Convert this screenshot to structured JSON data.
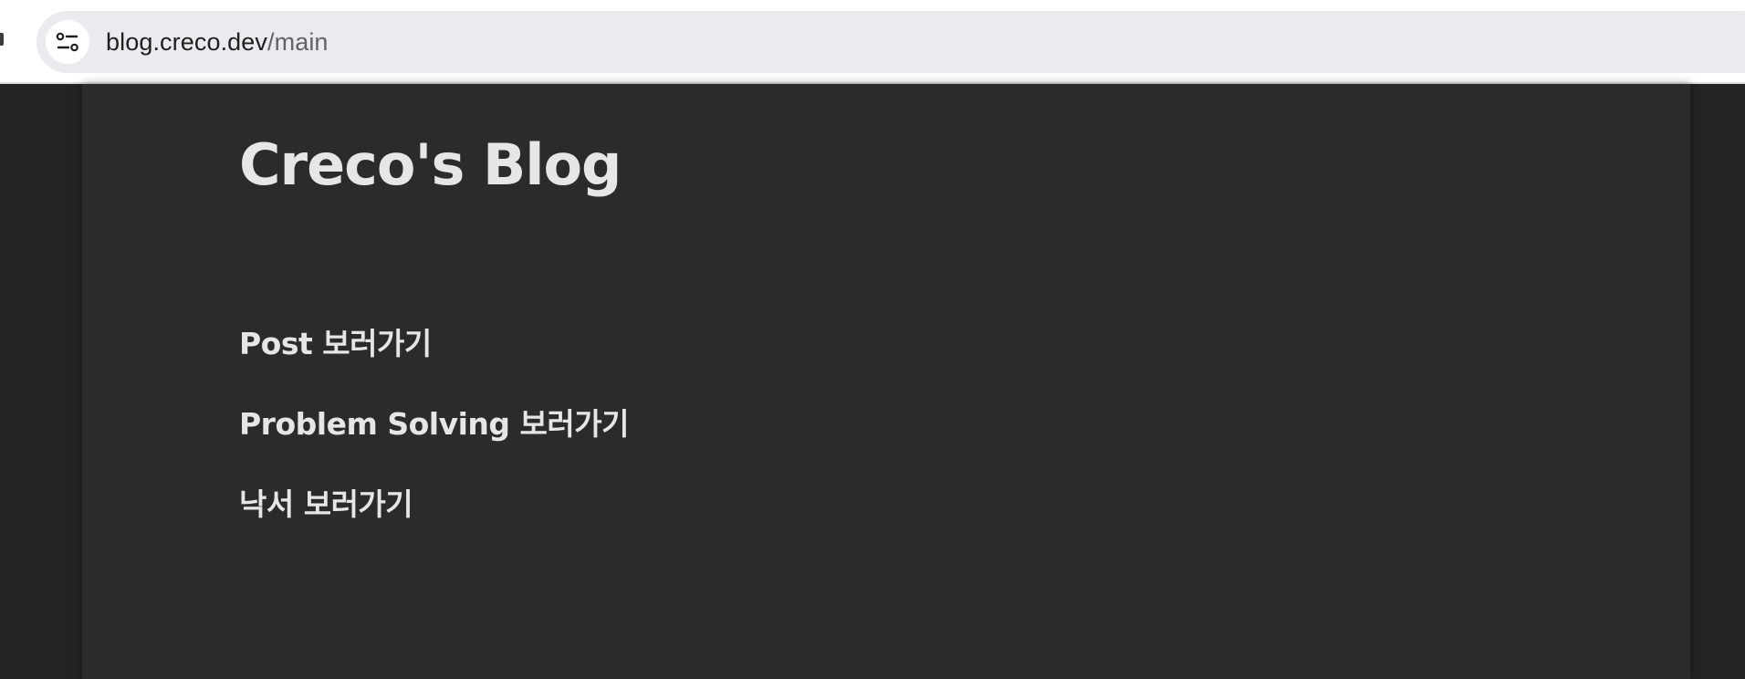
{
  "browser": {
    "site_info_icon": "tune-icon",
    "url_host": "blog.creco.dev",
    "url_path": "/main"
  },
  "page": {
    "title": "Creco's Blog",
    "links": [
      {
        "label": "Post 보러가기"
      },
      {
        "label": "Problem Solving 보러가기"
      },
      {
        "label": "낙서 보러가기"
      }
    ]
  },
  "colors": {
    "page_background": "#232323",
    "content_background": "#2b2b29",
    "text": "#e6e6e4",
    "omnibox": "#ebeaee"
  }
}
